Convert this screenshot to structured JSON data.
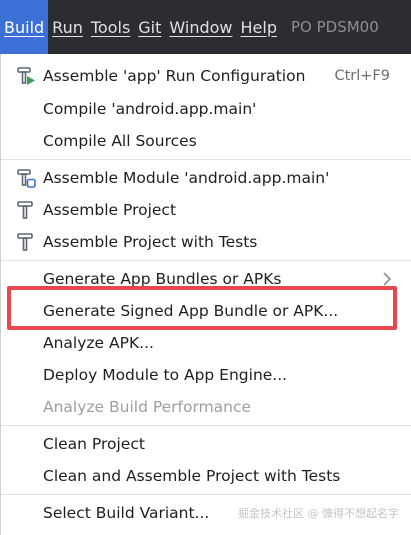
{
  "menubar": {
    "items": [
      "Build",
      "Run",
      "Tools",
      "Git",
      "Window",
      "Help"
    ],
    "project": "PO PDSM00"
  },
  "menu": {
    "items": [
      {
        "label": "Assemble 'app' Run Configuration",
        "shortcut": "Ctrl+F9",
        "icon": "hammer-run-icon"
      },
      {
        "label": "Compile 'android.app.main'"
      },
      {
        "label": "Compile All Sources"
      },
      {
        "label": "Assemble Module 'android.app.main'",
        "icon": "hammer-module-icon"
      },
      {
        "label": "Assemble Project",
        "icon": "hammer-icon"
      },
      {
        "label": "Assemble Project with Tests",
        "icon": "hammer-icon"
      },
      {
        "label": "Generate App Bundles or APKs",
        "submenu": true
      },
      {
        "label": "Generate Signed App Bundle or APK...",
        "highlighted": true
      },
      {
        "label": "Analyze APK..."
      },
      {
        "label": "Deploy Module to App Engine..."
      },
      {
        "label": "Analyze Build Performance",
        "disabled": true
      },
      {
        "label": "Clean Project"
      },
      {
        "label": "Clean and Assemble Project with Tests"
      },
      {
        "label": "Select Build Variant..."
      }
    ]
  },
  "watermark": "掘金技术社区 @ 慷得不想起名字",
  "colors": {
    "menubar_bg": "#2b2d30",
    "active_menu": "#3d70d6",
    "highlight_box": "#e8484d",
    "disabled_text": "#9aa0a6"
  }
}
